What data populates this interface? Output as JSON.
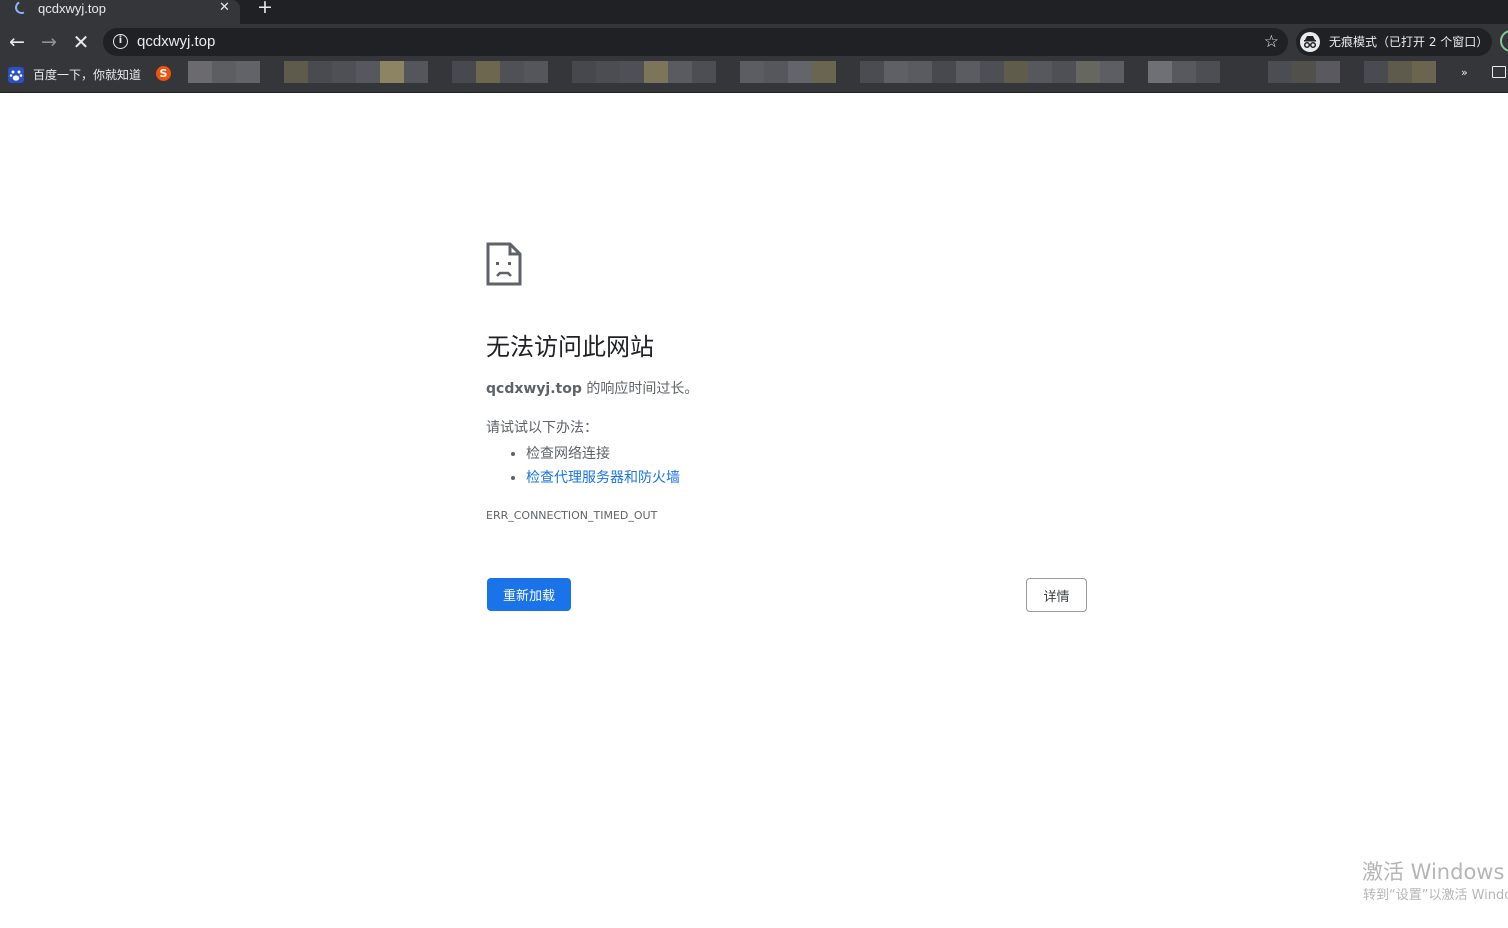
{
  "tab": {
    "title": "qcdxwyj.top",
    "close_glyph": "✕",
    "new_tab_glyph": "+"
  },
  "toolbar": {
    "back_glyph": "←",
    "forward_glyph": "→",
    "stop_glyph": "✕",
    "url": "qcdxwyj.top",
    "info_glyph": "i",
    "star_glyph": "☆",
    "incognito_label": "无痕模式（已打开 2 个窗口）"
  },
  "bookmarks": {
    "items": [
      {
        "label": "百度一下，你就知道",
        "icon": "baidu-paw-icon"
      },
      {
        "label": "",
        "icon": "s-logo-icon"
      }
    ],
    "more_glyph": "»"
  },
  "error_page": {
    "title": "无法访问此网站",
    "host": "qcdxwyj.top",
    "description_suffix": " 的响应时间过长。",
    "try_label": "请试试以下办法：",
    "suggestions": [
      "检查网络连接",
      "检查代理服务器和防火墙"
    ],
    "error_code": "ERR_CONNECTION_TIMED_OUT",
    "reload_label": "重新加载",
    "details_label": "详情"
  },
  "watermark": {
    "title": "激活 Windows",
    "subtitle": "转到“设置”以激活 Windows。"
  },
  "colors": {
    "accent": "#1a73e8",
    "chrome_dark": "#202124",
    "toolbar": "#35363a",
    "text_secondary": "#5f6368"
  }
}
